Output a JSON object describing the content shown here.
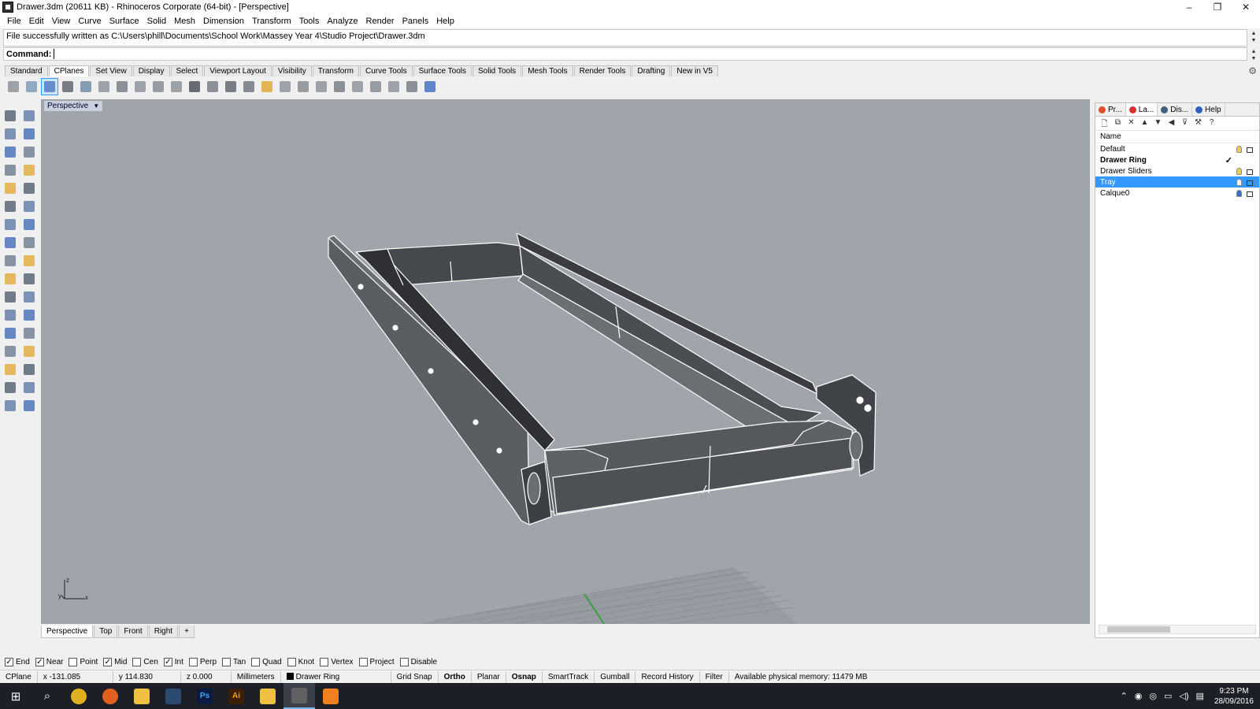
{
  "window": {
    "title": "Drawer.3dm (20611 KB) - Rhinoceros Corporate (64-bit) - [Perspective]",
    "minimize": "–",
    "restore": "❐",
    "close": "✕"
  },
  "menu": [
    "File",
    "Edit",
    "View",
    "Curve",
    "Surface",
    "Solid",
    "Mesh",
    "Dimension",
    "Transform",
    "Tools",
    "Analyze",
    "Render",
    "Panels",
    "Help"
  ],
  "command": {
    "history": "File successfully written as C:\\Users\\phill\\Documents\\School Work\\Massey Year 4\\Studio Project\\Drawer.3dm",
    "label": "Command:",
    "value": ""
  },
  "toolbar_tabs": [
    {
      "label": "Standard",
      "active": false
    },
    {
      "label": "CPlanes",
      "active": true
    },
    {
      "label": "Set View",
      "active": false
    },
    {
      "label": "Display",
      "active": false
    },
    {
      "label": "Select",
      "active": false
    },
    {
      "label": "Viewport Layout",
      "active": false
    },
    {
      "label": "Visibility",
      "active": false
    },
    {
      "label": "Transform",
      "active": false
    },
    {
      "label": "Curve Tools",
      "active": false
    },
    {
      "label": "Surface Tools",
      "active": false
    },
    {
      "label": "Solid Tools",
      "active": false
    },
    {
      "label": "Mesh Tools",
      "active": false
    },
    {
      "label": "Render Tools",
      "active": false
    },
    {
      "label": "Drafting",
      "active": false
    },
    {
      "label": "New in V5",
      "active": false
    }
  ],
  "viewport": {
    "label": "Perspective",
    "axes": {
      "z": "z",
      "y": "y",
      "x": "x"
    }
  },
  "viewport_tabs": [
    {
      "label": "Perspective",
      "active": true
    },
    {
      "label": "Top",
      "active": false
    },
    {
      "label": "Front",
      "active": false
    },
    {
      "label": "Right",
      "active": false
    },
    {
      "label": "+",
      "active": false
    }
  ],
  "panel": {
    "tabs": [
      {
        "label": "Pr...",
        "color": "#e05030",
        "active": false
      },
      {
        "label": "La...",
        "color": "#d83030",
        "active": true
      },
      {
        "label": "Dis...",
        "color": "#406080",
        "active": false
      },
      {
        "label": "Help",
        "color": "#3060c0",
        "active": false
      }
    ],
    "column_header": "Name",
    "layers": [
      {
        "name": "Default",
        "state": "normal",
        "bulb": "#f0d040"
      },
      {
        "name": "Drawer Ring",
        "state": "current",
        "bulb": ""
      },
      {
        "name": "Drawer Sliders",
        "state": "normal",
        "bulb": "#f0d040"
      },
      {
        "name": "Tray",
        "state": "selected",
        "bulb": "#ffffff"
      },
      {
        "name": "Calque0",
        "state": "normal",
        "bulb": "#3070d0"
      }
    ],
    "current_mark": "✓"
  },
  "osnaps": [
    {
      "label": "End",
      "checked": true
    },
    {
      "label": "Near",
      "checked": true
    },
    {
      "label": "Point",
      "checked": false
    },
    {
      "label": "Mid",
      "checked": true
    },
    {
      "label": "Cen",
      "checked": false
    },
    {
      "label": "Int",
      "checked": true
    },
    {
      "label": "Perp",
      "checked": false
    },
    {
      "label": "Tan",
      "checked": false
    },
    {
      "label": "Quad",
      "checked": false
    },
    {
      "label": "Knot",
      "checked": false
    },
    {
      "label": "Vertex",
      "checked": false
    },
    {
      "label": "Project",
      "checked": false
    },
    {
      "label": "Disable",
      "checked": false
    }
  ],
  "status": {
    "cplane": "CPlane",
    "x": "x -131.085",
    "y": "y 114.830",
    "z": "z 0.000",
    "units": "Millimeters",
    "layer": "Drawer Ring",
    "grid_snap": "Grid Snap",
    "ortho": "Ortho",
    "planar": "Planar",
    "osnap": "Osnap",
    "smarttrack": "SmartTrack",
    "gumball": "Gumball",
    "record_history": "Record History",
    "filter": "Filter",
    "memory": "Available physical memory: 11479 MB"
  },
  "taskbar": {
    "apps": [
      {
        "name": "chrome",
        "label": "",
        "color": "#e0b020"
      },
      {
        "name": "firefox",
        "label": "",
        "color": "#e06020"
      },
      {
        "name": "explorer",
        "label": "",
        "color": "#f0c040"
      },
      {
        "name": "steam",
        "label": "",
        "color": "#2a4a70"
      },
      {
        "name": "photoshop",
        "label": "Ps",
        "color": "#0a1a40"
      },
      {
        "name": "illustrator",
        "label": "Ai",
        "color": "#3a2000"
      },
      {
        "name": "folder",
        "label": "",
        "color": "#f0c040"
      },
      {
        "name": "rhino",
        "label": "",
        "color": "#606060"
      },
      {
        "name": "vlc",
        "label": "",
        "color": "#f08020"
      }
    ],
    "time": "9:23 PM",
    "date": "28/09/2016"
  }
}
